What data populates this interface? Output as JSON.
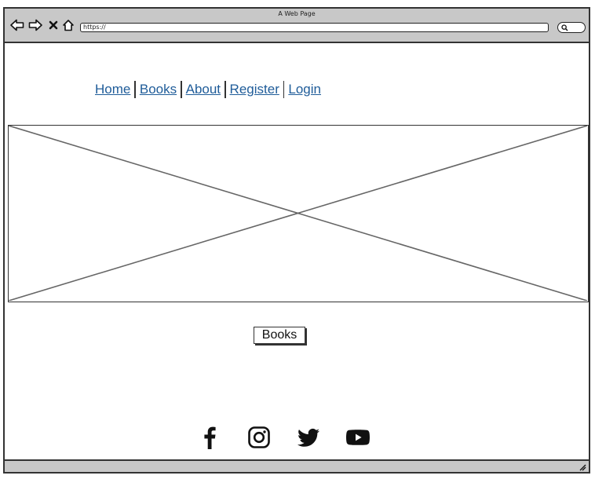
{
  "window": {
    "title": "A Web Page",
    "url": "https://"
  },
  "toolbar": {
    "icons": [
      "back-arrow-icon",
      "forward-arrow-icon",
      "close-icon",
      "home-icon",
      "search-icon"
    ]
  },
  "nav": {
    "items": [
      {
        "label": "Home"
      },
      {
        "label": "Books"
      },
      {
        "label": "About"
      },
      {
        "label": "Register"
      },
      {
        "label": "Login"
      }
    ],
    "link_color": "#1f5c99"
  },
  "hero": {
    "type": "image-placeholder"
  },
  "main": {
    "button_label": "Books"
  },
  "footer": {
    "social_icons": [
      "facebook-icon",
      "instagram-icon",
      "twitter-icon",
      "youtube-icon"
    ]
  },
  "colors": {
    "chrome": "#c8c8c8",
    "border": "#333333"
  }
}
